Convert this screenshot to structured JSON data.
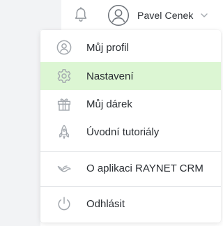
{
  "header": {
    "user_name": "Pavel Cenek",
    "icons": {
      "notifications": "bell-icon",
      "avatar": "user-avatar-icon",
      "dropdown": "chevron-down-icon"
    }
  },
  "menu": {
    "items": [
      {
        "label": "Můj profil",
        "icon": "user-circle-icon",
        "active": false
      },
      {
        "label": "Nastavení",
        "icon": "gear-icon",
        "active": true
      },
      {
        "label": "Můj dárek",
        "icon": "gift-icon",
        "active": false
      },
      {
        "label": "Úvodní tutoriály",
        "icon": "rocket-icon",
        "active": false
      },
      {
        "label": "O aplikaci RAYNET CRM",
        "icon": "raynet-logo-icon",
        "active": false
      },
      {
        "label": "Odhlásit",
        "icon": "power-icon",
        "active": false
      }
    ]
  },
  "colors": {
    "active_item_background": "#dcf6d3",
    "icon_gray": "#a3a8ae",
    "text": "#2a2e33",
    "sidebar_background": "#f2f3f5"
  }
}
